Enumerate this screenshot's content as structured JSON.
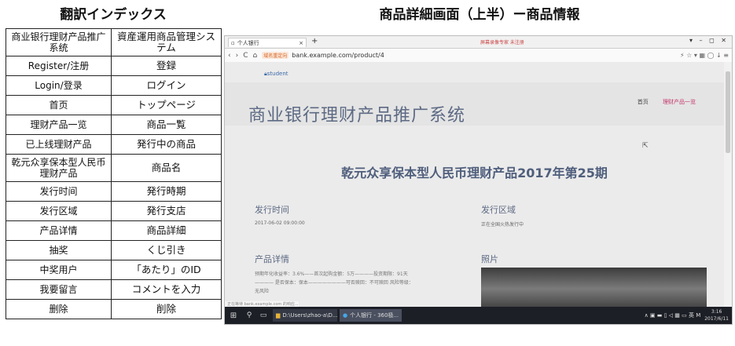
{
  "index": {
    "title": "翻訳インデックス",
    "rows": [
      {
        "zh": "商业银行理财产品推广系统",
        "jp": "資産運用商品管理システム"
      },
      {
        "zh": "Register/注册",
        "jp": "登録"
      },
      {
        "zh": "Login/登录",
        "jp": "ログイン"
      },
      {
        "zh": "首页",
        "jp": "トップページ"
      },
      {
        "zh": "理财产品一览",
        "jp": "商品一覧"
      },
      {
        "zh": "已上线理财产品",
        "jp": "発行中の商品"
      },
      {
        "zh": "乾元众享保本型人民币理财产品",
        "jp": "商品名"
      },
      {
        "zh": "发行时间",
        "jp": "発行時期"
      },
      {
        "zh": "发行区域",
        "jp": "発行支店"
      },
      {
        "zh": "产品详情",
        "jp": "商品詳細"
      },
      {
        "zh": "抽奖",
        "jp": "くじ引き"
      },
      {
        "zh": "中奖用户",
        "jp": "「あたり」のID"
      },
      {
        "zh": "我要留言",
        "jp": "コメントを入力"
      },
      {
        "zh": "删除",
        "jp": "削除"
      }
    ]
  },
  "screenshot": {
    "title": "商品詳細画面（上半）ー商品情報",
    "browser": {
      "tab_label": "个人银行",
      "tab_close": "×",
      "new_tab": "+",
      "tab_center_text": "屏幕录像专家 未注册",
      "window_controls": "▾ – ◻ ✕",
      "nav_icons": {
        "back": "‹",
        "forward": "›",
        "reload": "C",
        "home": "⌂"
      },
      "url_badge": "域名重定向",
      "url": "bank.example.com/product/4",
      "right_icons": "⚡ ☆ ▾ ▦ ◯ ↓ ≡",
      "status_text": "正在等待 bank.example.com 的响应..."
    },
    "page": {
      "user": "student",
      "site_name": "商业银行理财产品推广系统",
      "nav": {
        "home": "首页",
        "list": "理财产品一览"
      },
      "product_title": "乾元众享保本型人民币理财产品2017年第25期",
      "issue_time_label": "发行时间",
      "issue_time_value": "2017-06-02 09:00:00",
      "issue_region_label": "发行区域",
      "issue_region_value": "正在全国火热发行中",
      "detail_label": "产品详情",
      "detail_text": "预期年化收益率：3.6%——首次起购金额：5万————投资期限：91天———— 是否保本：保本————————可否赎回：不可赎回 风险等级：无风险",
      "photo_label": "照片"
    },
    "taskbar": {
      "start": "⊞",
      "search": "⚲",
      "taskview": "▭",
      "explorer": "D:\\Users\\zhao-a\\D...",
      "browser": "个人银行 - 360极...",
      "tray_icons": "∧ ▣ ▬ ▯ ◁ ▦ ▭ 英 M",
      "time": "3:16",
      "date": "2017/6/11"
    }
  }
}
